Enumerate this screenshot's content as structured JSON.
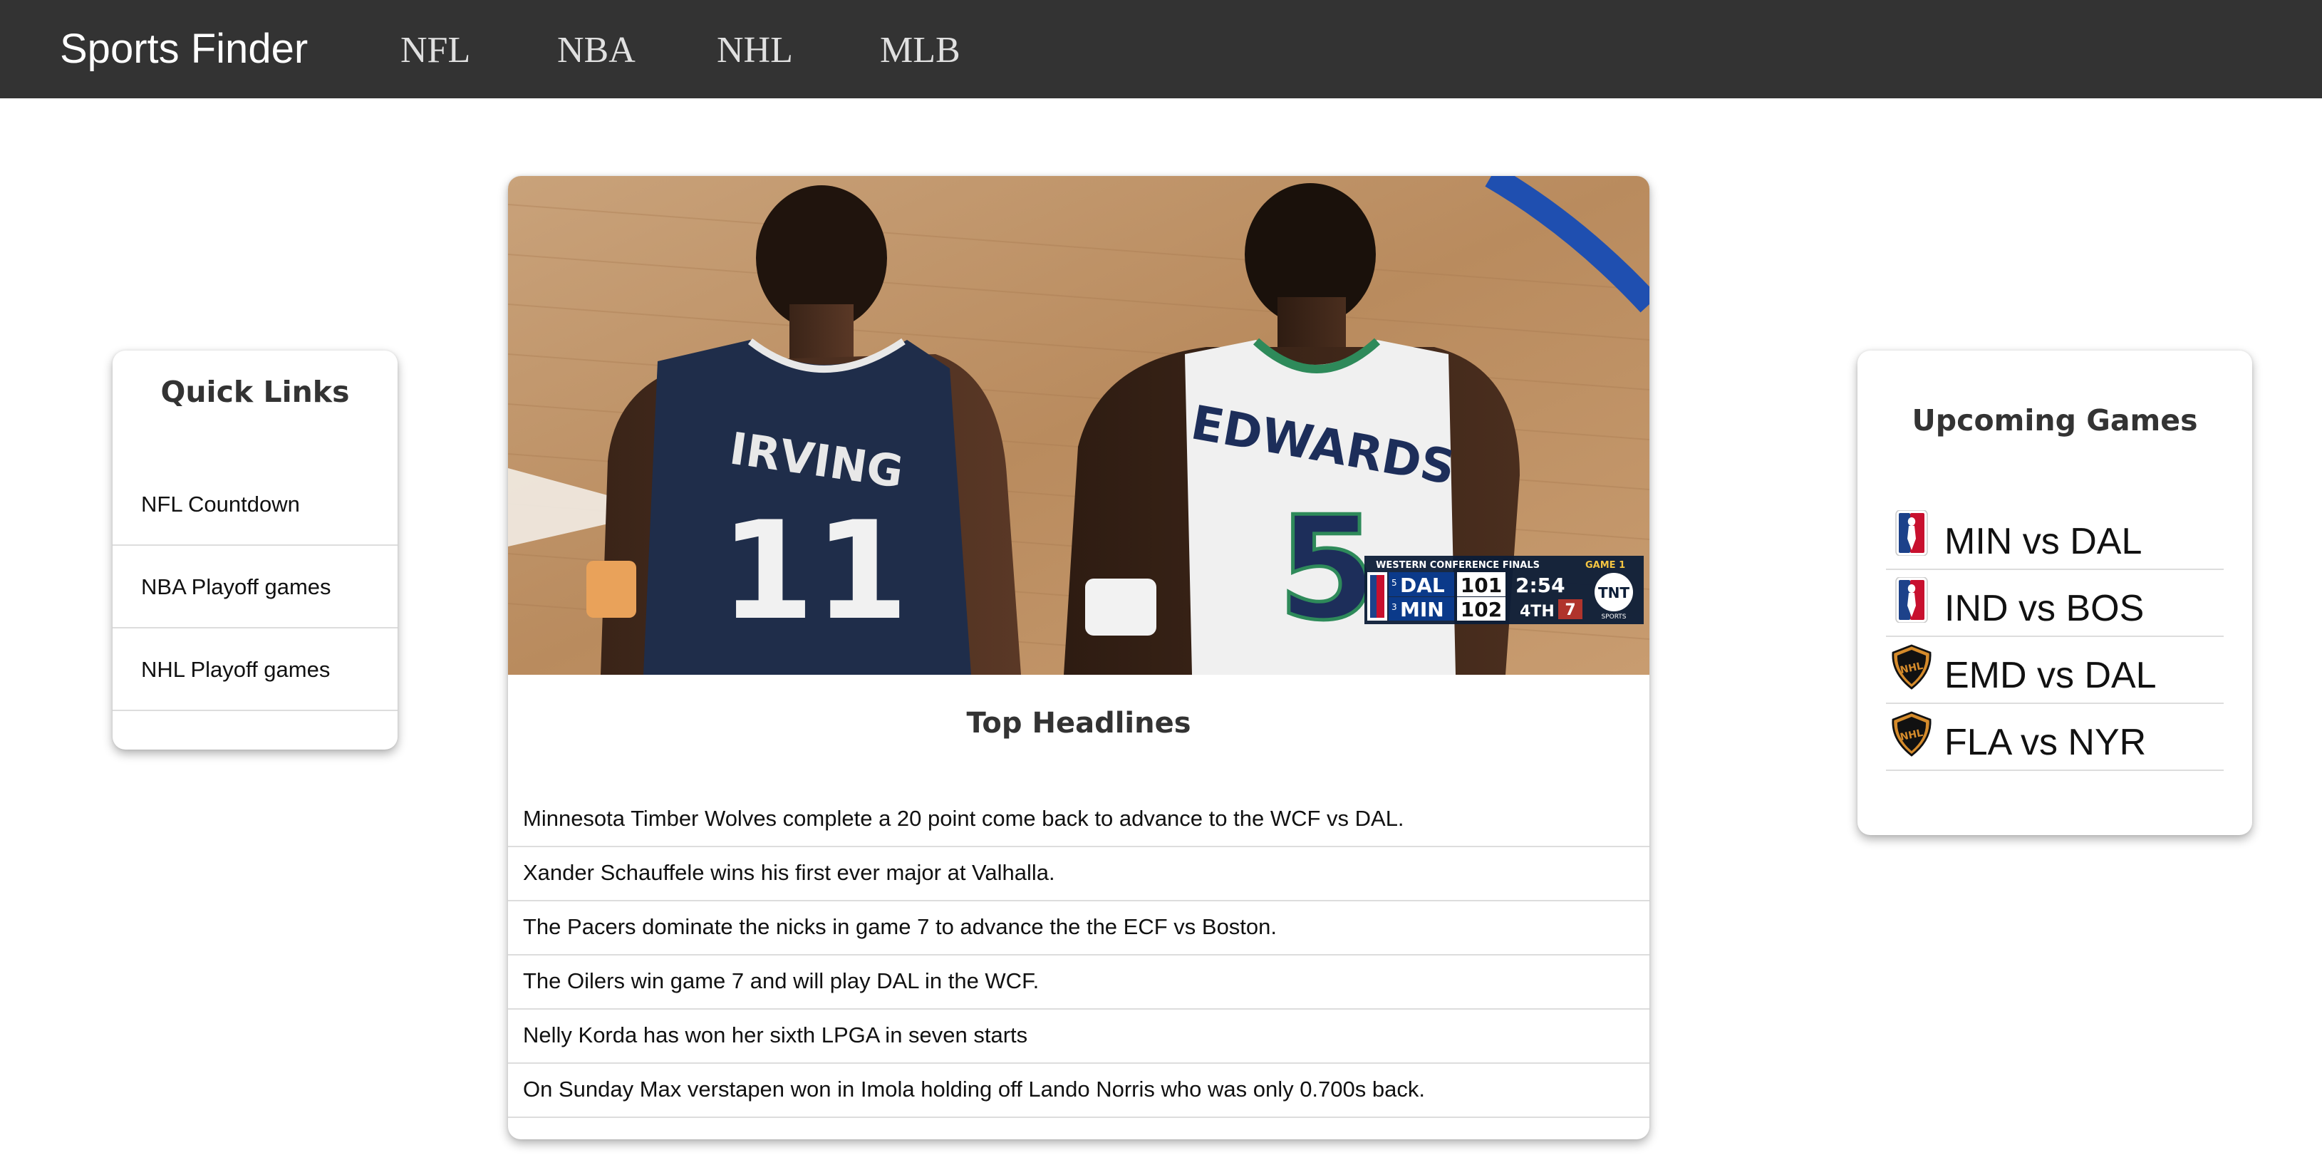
{
  "nav": {
    "brand": "Sports Finder",
    "links": [
      "NFL",
      "NBA",
      "NHL",
      "MLB"
    ]
  },
  "quick_links": {
    "title": "Quick Links",
    "items": [
      "NFL Countdown",
      "NBA Playoff games",
      "NHL Playoff games"
    ]
  },
  "hero": {
    "scorebug": {
      "series": "WESTERN CONFERENCE FINALS",
      "game": "GAME 1",
      "team1_seed": "5",
      "team1": "DAL",
      "team1_score": "101",
      "team2_seed": "3",
      "team2": "MIN",
      "team2_score": "102",
      "clock": "2:54",
      "period": "4TH",
      "shot_clock": "7",
      "network": "TNT",
      "network_sub": "SPORTS"
    },
    "jersey_left_name": "IRVING",
    "jersey_left_number": "11",
    "jersey_right_name": "EDWARDS",
    "jersey_right_number": "5"
  },
  "headlines": {
    "title": "Top Headlines",
    "items": [
      "Minnesota Timber Wolves complete a 20 point come back to advance to the WCF vs DAL.",
      "Xander Schauffele wins his first ever major at Valhalla.",
      "The Pacers dominate the nicks in game 7 to advance the the ECF vs Boston.",
      "The Oilers win game 7 and will play DAL in the WCF.",
      "Nelly Korda has won her sixth LPGA in seven starts",
      "On Sunday Max verstapen won in Imola holding off Lando Norris who was only 0.700s back."
    ]
  },
  "upcoming": {
    "title": "Upcoming Games",
    "games": [
      {
        "league_icon": "nba-logo-icon",
        "matchup": "MIN vs DAL"
      },
      {
        "league_icon": "nba-logo-icon",
        "matchup": "IND vs BOS"
      },
      {
        "league_icon": "nhl-logo-icon",
        "matchup": "EMD vs DAL"
      },
      {
        "league_icon": "nhl-logo-icon",
        "matchup": "FLA vs NYR"
      }
    ]
  },
  "colors": {
    "nav_bg": "#333333",
    "nba_red": "#c8102e",
    "nba_blue": "#1d428a",
    "nhl_orange": "#d58b2b"
  }
}
